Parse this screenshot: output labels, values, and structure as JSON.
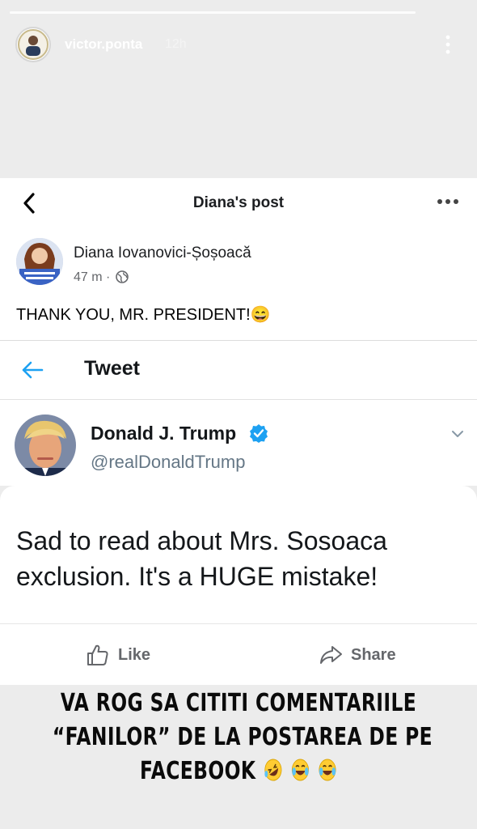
{
  "story": {
    "username": "victor.ponta",
    "time_ago": "12h"
  },
  "facebook": {
    "header_title": "Diana's post",
    "author": "Diana Iovanovici-Șoșoacă",
    "meta_time": "47 m ·",
    "post_text": "THANK YOU, MR. PRESIDENT!😄"
  },
  "tweet": {
    "header_label": "Tweet",
    "author_name": "Donald J. Trump",
    "handle": "@realDonaldTrump",
    "text_line1": "Sad to read about Mrs. Sosoaca",
    "text_line2": "exclusion. It's a HUGE mistake!"
  },
  "actions": {
    "like_label": "Like",
    "share_label": "Share"
  },
  "caption": {
    "line1": "VA ROG SA CITITI COMENTARIILE",
    "line2": "“FANILOR” DE LA POSTAREA DE PE",
    "line3": "FACEBOOK"
  },
  "colors": {
    "twitter_blue": "#1da1f2",
    "fb_text": "#1c1e21",
    "story_bg": "#ececec"
  }
}
